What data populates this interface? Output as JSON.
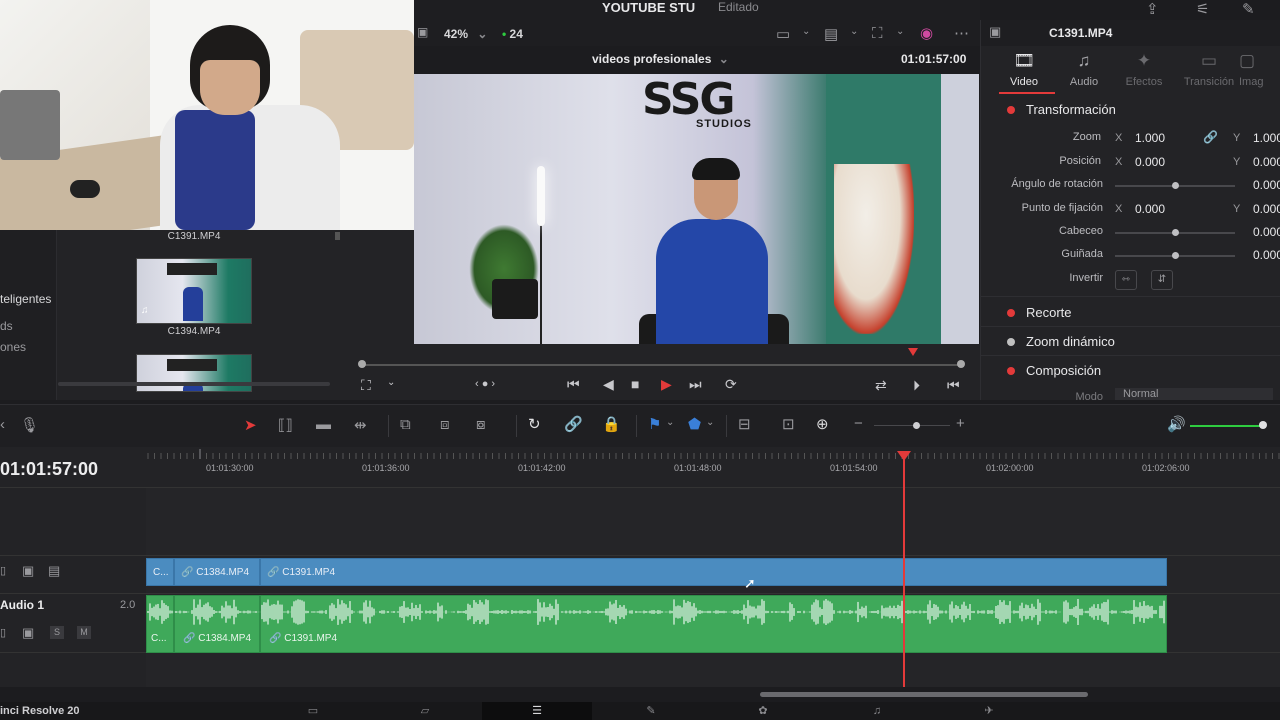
{
  "window": {
    "project_title": "YOUTUBE STU",
    "edit_state": "Editado"
  },
  "viewer": {
    "zoom": "42%",
    "fps": "24",
    "clip_name": "videos profesionales",
    "timecode": "01:01:57:00"
  },
  "video_overlay": {
    "logo": "SSG",
    "studios": "STUDIOS"
  },
  "media_pool": {
    "sidebar_items": [
      "teligentes",
      "ds",
      "ones"
    ],
    "clips": [
      {
        "name": "C1391.MP4"
      },
      {
        "name": "C1394.MP4"
      }
    ]
  },
  "inspector": {
    "clip_name": "C1391.MP4",
    "tabs": [
      {
        "label": "Video",
        "icon": "video-icon"
      },
      {
        "label": "Audio",
        "icon": "music-note-icon"
      },
      {
        "label": "Efectos",
        "icon": "effects-icon"
      },
      {
        "label": "Transición",
        "icon": "transition-icon"
      },
      {
        "label": "Imag",
        "icon": "image-icon"
      }
    ],
    "sections": {
      "transform": "Transformación",
      "crop": "Recorte",
      "dynamic_zoom": "Zoom dinámico",
      "composite": "Composición"
    },
    "params": {
      "zoom_label": "Zoom",
      "zoom_x": "1.000",
      "zoom_y": "1.000",
      "position_label": "Posición",
      "position_x": "0.000",
      "position_y": "0.000",
      "rotation_label": "Ángulo de rotación",
      "rotation_val": "0.000",
      "anchor_label": "Punto de fijación",
      "anchor_x": "0.000",
      "anchor_y": "0.000",
      "pitch_label": "Cabeceo",
      "pitch_val": "0.000",
      "yaw_label": "Guiñada",
      "yaw_val": "0.000",
      "flip_label": "Invertir",
      "mode_label": "Modo",
      "mode_val": "Normal",
      "axis_x": "X",
      "axis_y": "Y"
    }
  },
  "timeline": {
    "timecode": "01:01:57:00",
    "ruler": [
      "01:01:30:00",
      "01:01:36:00",
      "01:01:42:00",
      "01:01:48:00",
      "01:01:54:00",
      "01:02:00:00",
      "01:02:06:00"
    ],
    "audio_track_name": "Audio 1",
    "audio_track_channels": "2.0",
    "audio_track_s": "S",
    "audio_track_m": "M",
    "video_clips": [
      "C...",
      "C1384.MP4",
      "C1391.MP4"
    ],
    "audio_clips": [
      "C...",
      "C1384.MP4",
      "C1391.MP4"
    ]
  },
  "pages": {
    "app_name": "inci Resolve 20",
    "items": [
      "media-page-icon",
      "cut-page-icon",
      "edit-page-icon",
      "fusion-page-icon",
      "color-page-icon",
      "fairlight-page-icon",
      "deliver-page-icon"
    ],
    "active": 2
  },
  "colors": {
    "accent_red": "#e33a3a",
    "video_clip": "#4b8cc0",
    "audio_clip": "#3fa95a",
    "volume_green": "#2ecc40"
  }
}
